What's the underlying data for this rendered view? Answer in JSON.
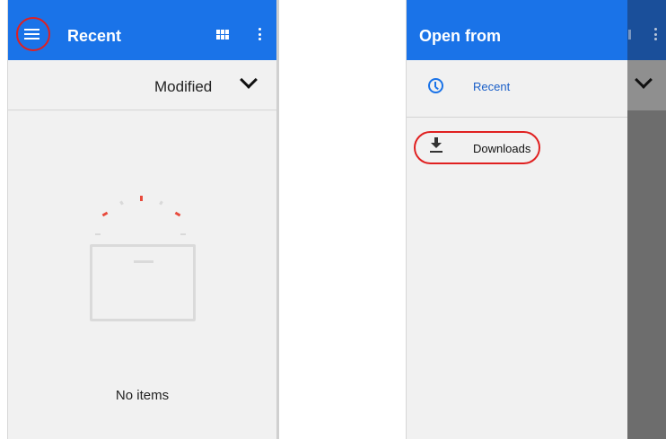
{
  "left_screen": {
    "appbar": {
      "title": "Recent",
      "menu_icon": "hamburger-menu-icon",
      "grid_icon": "grid-view-icon",
      "overflow_icon": "more-vert-icon",
      "color": "#1a73e8"
    },
    "sort": {
      "label": "Modified",
      "icon": "chevron-down-icon"
    },
    "empty_state": {
      "illustration": "empty-box-icon",
      "message": "No items"
    }
  },
  "right_screen": {
    "drawer": {
      "title": "Open from",
      "items": [
        {
          "label": "Recent",
          "icon": "clock-icon",
          "selected": true
        },
        {
          "label": "Downloads",
          "icon": "download-icon",
          "selected": false
        }
      ]
    }
  },
  "annotations": {
    "highlight_color": "#e02020"
  }
}
